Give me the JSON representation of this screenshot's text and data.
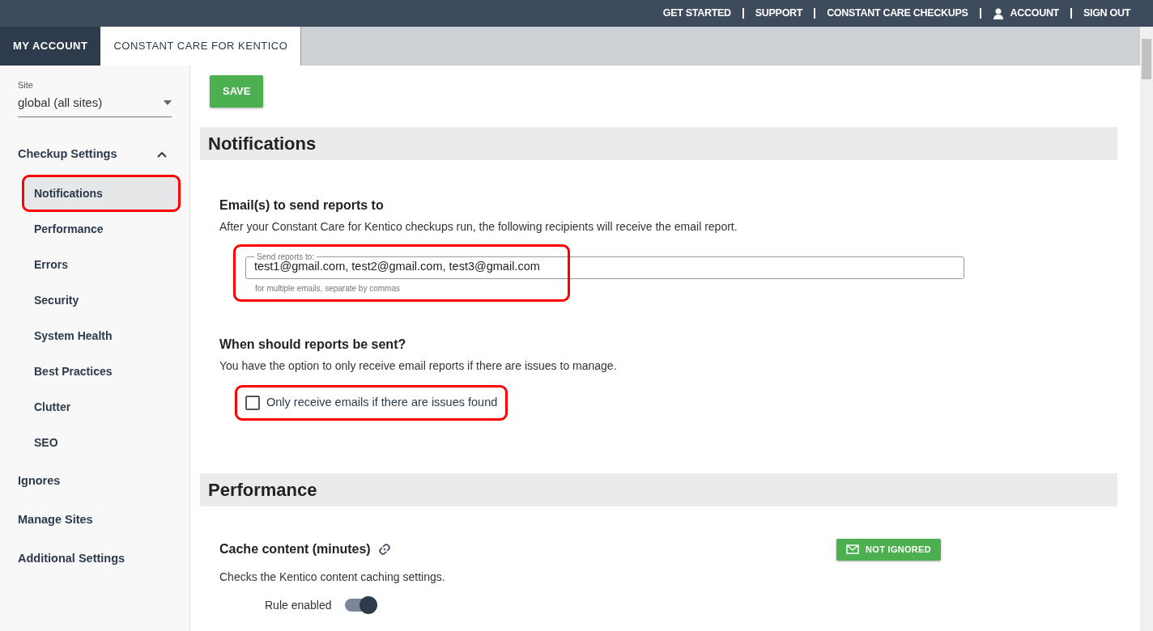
{
  "top_links": [
    {
      "label": "GET STARTED",
      "kind": "link"
    },
    {
      "label": "SUPPORT",
      "kind": "link"
    },
    {
      "label": "CONSTANT CARE CHECKUPS",
      "kind": "link"
    },
    {
      "label": "ACCOUNT",
      "kind": "account"
    },
    {
      "label": "SIGN OUT",
      "kind": "link"
    }
  ],
  "tabs": [
    {
      "label": "MY ACCOUNT",
      "selected": false
    },
    {
      "label": "CONSTANT CARE FOR KENTICO",
      "selected": true
    }
  ],
  "sidebar": {
    "site_field": {
      "label": "Site",
      "value": "global (all sites)"
    },
    "items": [
      {
        "label": "Checkup Settings",
        "expanded": true,
        "children": [
          {
            "label": "Notifications",
            "selected": true,
            "highlighted": true
          },
          {
            "label": "Performance",
            "selected": false,
            "highlighted": false
          },
          {
            "label": "Errors",
            "selected": false,
            "highlighted": false
          },
          {
            "label": "Security",
            "selected": false,
            "highlighted": false
          },
          {
            "label": "System Health",
            "selected": false,
            "highlighted": false
          },
          {
            "label": "Best Practices",
            "selected": false,
            "highlighted": false
          },
          {
            "label": "Clutter",
            "selected": false,
            "highlighted": false
          },
          {
            "label": "SEO",
            "selected": false,
            "highlighted": false
          }
        ]
      },
      {
        "label": "Ignores"
      },
      {
        "label": "Manage Sites"
      },
      {
        "label": "Additional Settings"
      }
    ]
  },
  "save_button": "SAVE",
  "sections": [
    {
      "title": "Notifications",
      "blocks": [
        {
          "kind": "email",
          "heading": "Email(s) to send reports to",
          "description": "After your Constant Care for Kentico checkups run, the following recipients will receive the email report.",
          "field": {
            "label": "Send reports to:",
            "value": "test1@gmail.com, test2@gmail.com, test3@gmail.com",
            "hint": "for multiple emails, separate by commas"
          },
          "highlighted": true
        },
        {
          "kind": "checkbox",
          "heading": "When should reports be sent?",
          "description": "You have the option to only receive email reports if there are issues to manage.",
          "checkbox": {
            "label": "Only receive emails if there are issues found",
            "checked": false
          },
          "highlighted": true
        }
      ]
    },
    {
      "title": "Performance",
      "blocks": [
        {
          "kind": "rule",
          "heading": "Cache content (minutes)",
          "description": "Checks the Kentico content caching settings.",
          "status": "NOT IGNORED",
          "toggle": {
            "label": "Rule enabled",
            "on": true
          }
        }
      ]
    }
  ]
}
